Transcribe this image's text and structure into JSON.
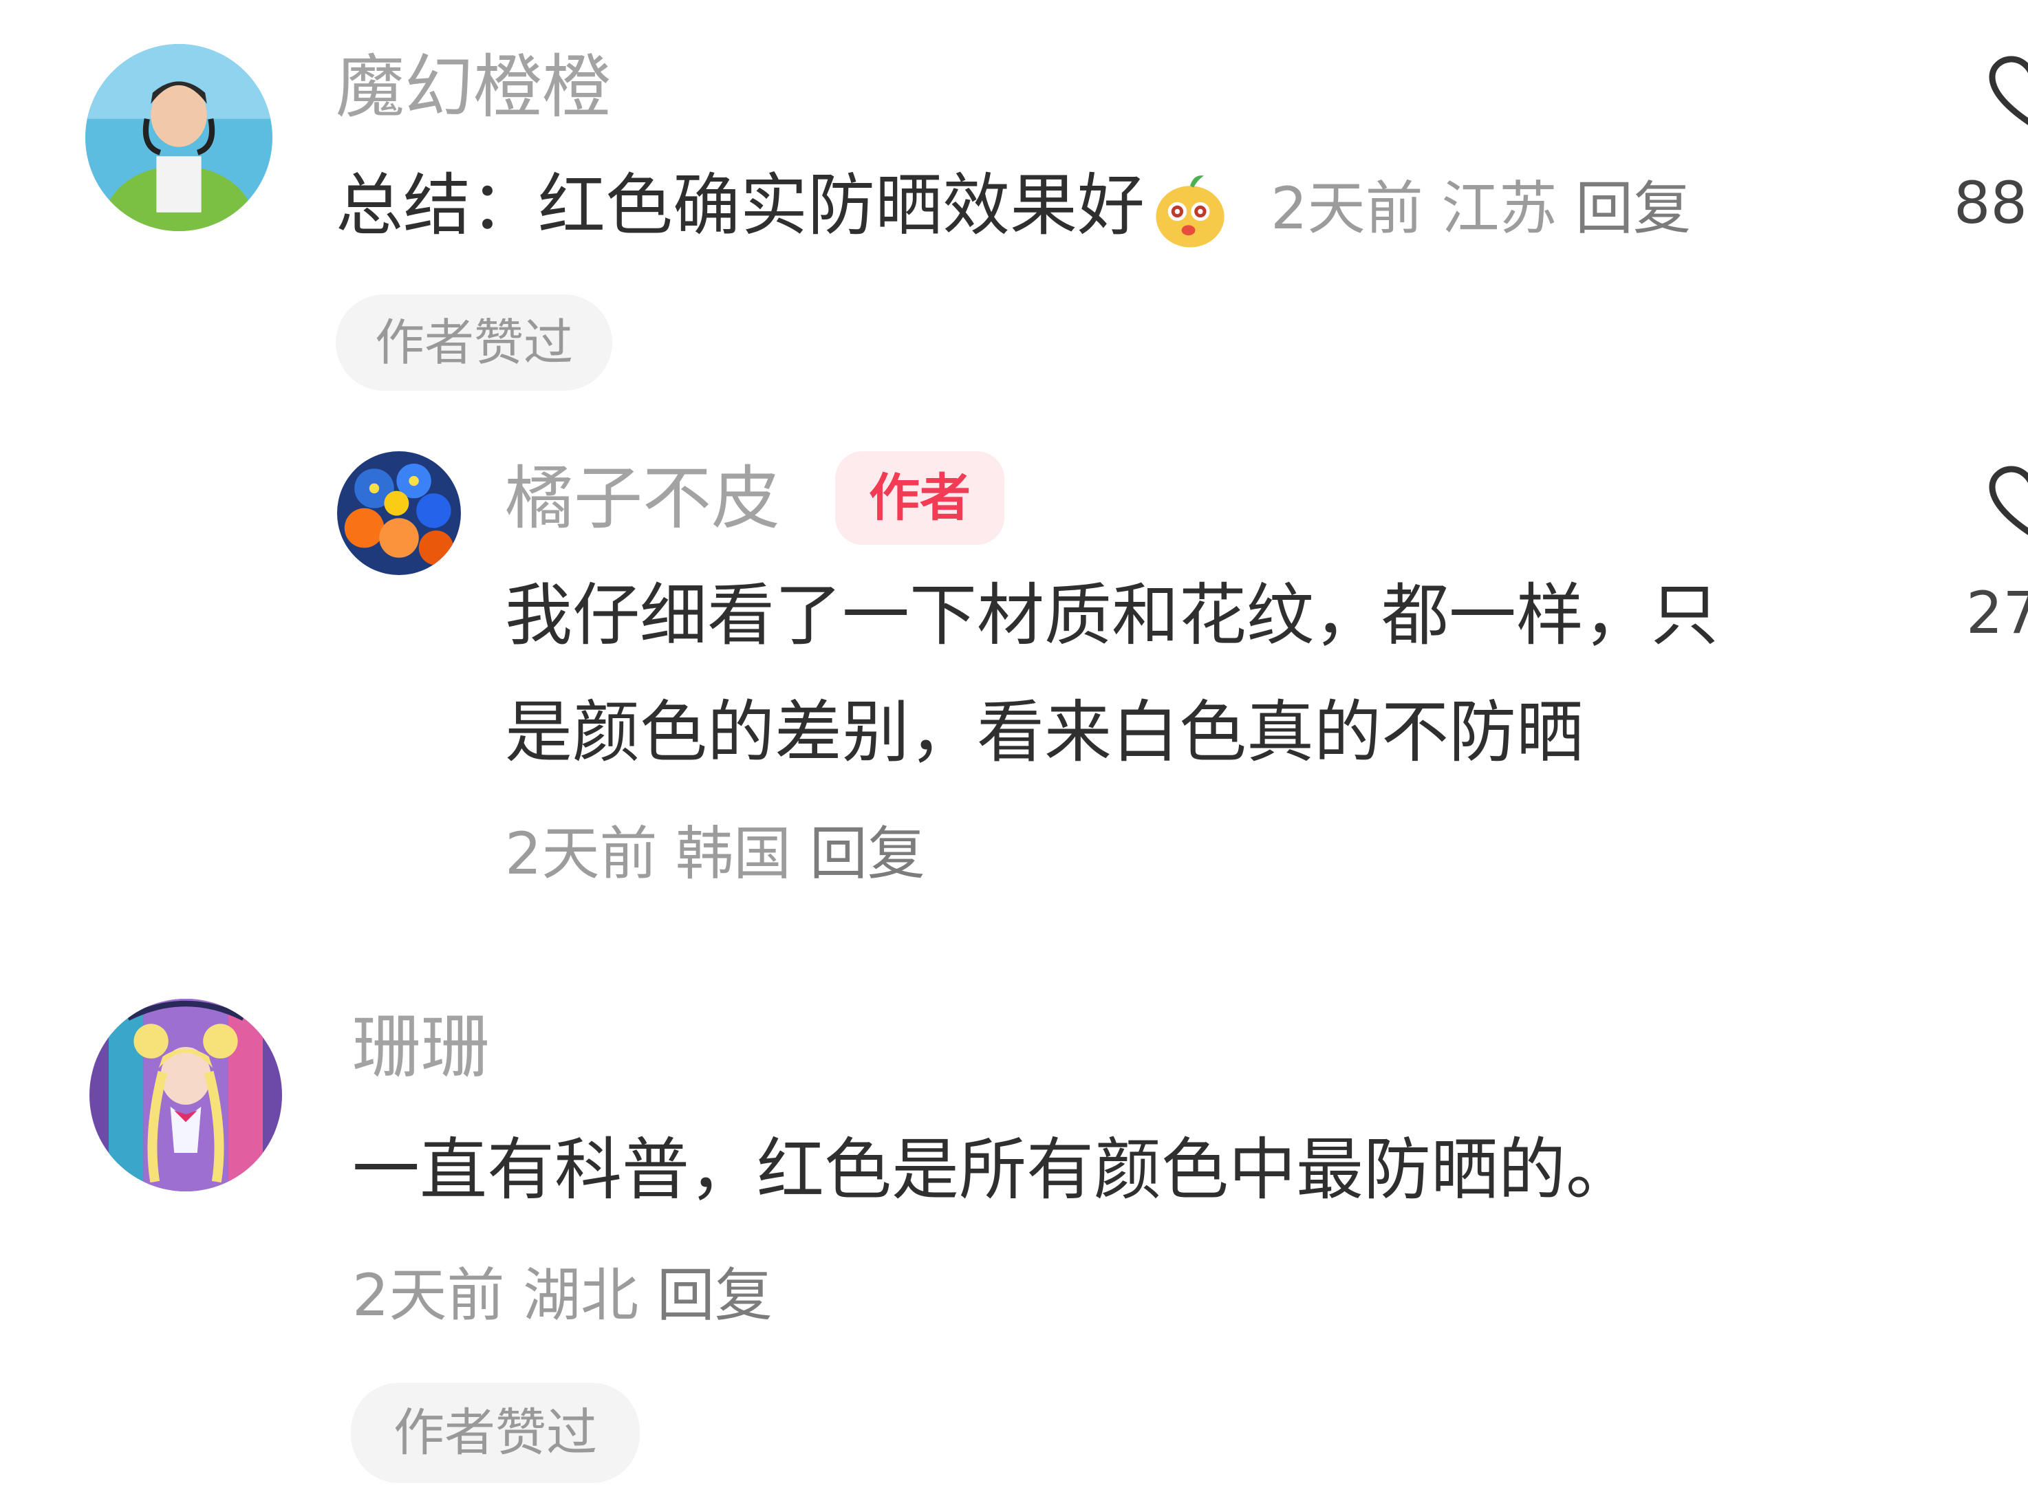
{
  "comments": [
    {
      "username": "魔幻橙橙",
      "text": "总结：红色确实防晒效果好",
      "emoji": "orange-face-emoji",
      "time": "2天前",
      "location": "江苏",
      "reply_label": "回复",
      "liked_tag": "作者赞过",
      "like_count": "88",
      "replies": [
        {
          "username": "橘子不皮",
          "badge": "作者",
          "text_line1": "我仔细看了一下材质和花纹，都一样，只",
          "text_line2": "是颜色的差别，看来白色真的不防晒",
          "time": "2天前",
          "location": "韩国",
          "reply_label": "回复",
          "like_count": "27"
        }
      ]
    },
    {
      "username": "珊珊",
      "text": "一直有科普，红色是所有颜色中最防晒的。",
      "time": "2天前",
      "location": "湖北",
      "reply_label": "回复",
      "liked_tag": "作者赞过"
    }
  ],
  "colors": {
    "username": "#a3a3a3",
    "text": "#2f2f2f",
    "meta": "#9c9c9c",
    "author_badge_bg": "#fdebee",
    "author_badge_text": "#f23c55",
    "pill_bg": "#f4f4f4"
  }
}
